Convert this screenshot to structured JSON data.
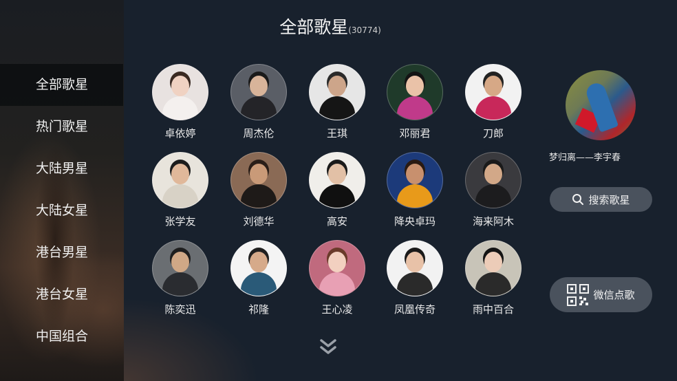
{
  "header": {
    "title": "全部歌星",
    "count": "(30774)"
  },
  "sidebar": {
    "items": [
      {
        "label": "全部歌星",
        "active": true
      },
      {
        "label": "热门歌星",
        "active": false
      },
      {
        "label": "大陆男星",
        "active": false
      },
      {
        "label": "大陆女星",
        "active": false
      },
      {
        "label": "港台男星",
        "active": false
      },
      {
        "label": "港台女星",
        "active": false
      },
      {
        "label": "中国组合",
        "active": false
      }
    ]
  },
  "singers": [
    {
      "name": "卓依婷",
      "bg": "#e8e2e0",
      "skin": "#f0d2c2",
      "hair": "#3a2a22",
      "cloth": "#f4f0ee"
    },
    {
      "name": "周杰伦",
      "bg": "#5a5e66",
      "skin": "#d8b49a",
      "hair": "#1a1a1a",
      "cloth": "#242428"
    },
    {
      "name": "王琪",
      "bg": "#e6e6e6",
      "skin": "#cda58a",
      "hair": "#2a2a2a",
      "cloth": "#151515"
    },
    {
      "name": "邓丽君",
      "bg": "#1f3a2a",
      "skin": "#eac2a8",
      "hair": "#141414",
      "cloth": "#c03a8a"
    },
    {
      "name": "刀郎",
      "bg": "#f2f2f2",
      "skin": "#d6a886",
      "hair": "#222222",
      "cloth": "#c8285a"
    },
    {
      "name": "张学友",
      "bg": "#e8e4dc",
      "skin": "#e0b89a",
      "hair": "#1c1c1c",
      "cloth": "#d8d2c6"
    },
    {
      "name": "刘德华",
      "bg": "#8a6a55",
      "skin": "#c99a78",
      "hair": "#2a1e18",
      "cloth": "#1e1a18"
    },
    {
      "name": "高安",
      "bg": "#f0eeea",
      "skin": "#e2c0a6",
      "hair": "#1a1a1a",
      "cloth": "#101010"
    },
    {
      "name": "降央卓玛",
      "bg": "#1c3a7a",
      "skin": "#c8906e",
      "hair": "#2a1a12",
      "cloth": "#e89a1a"
    },
    {
      "name": "海来阿木",
      "bg": "#3a3a3e",
      "skin": "#d2a888",
      "hair": "#1a1a1a",
      "cloth": "#1c1c1e"
    },
    {
      "name": "陈奕迅",
      "bg": "#6a6e72",
      "skin": "#d0a886",
      "hair": "#1e1e1e",
      "cloth": "#2a2c30"
    },
    {
      "name": "祁隆",
      "bg": "#f4f4f4",
      "skin": "#d6aa8a",
      "hair": "#202020",
      "cloth": "#2a5a78"
    },
    {
      "name": "王心凌",
      "bg": "#c06a7e",
      "skin": "#f2d0c0",
      "hair": "#6a3a2a",
      "cloth": "#e8a0b4"
    },
    {
      "name": "凤凰传奇",
      "bg": "#f2f2f2",
      "skin": "#e8c2a8",
      "hair": "#1a1a1a",
      "cloth": "#2a2a2a"
    },
    {
      "name": "雨中百合",
      "bg": "#c8c4b8",
      "skin": "#ecccb8",
      "hair": "#141414",
      "cloth": "#2a2a2a"
    }
  ],
  "now_playing": {
    "title": "梦归离——李宇春"
  },
  "buttons": {
    "search": "搜索歌星",
    "wechat": "微信点歌"
  },
  "icons": {
    "search": "search-icon",
    "wechat_qr": "qr-code-icon",
    "more": "double-chevron-down-icon"
  }
}
